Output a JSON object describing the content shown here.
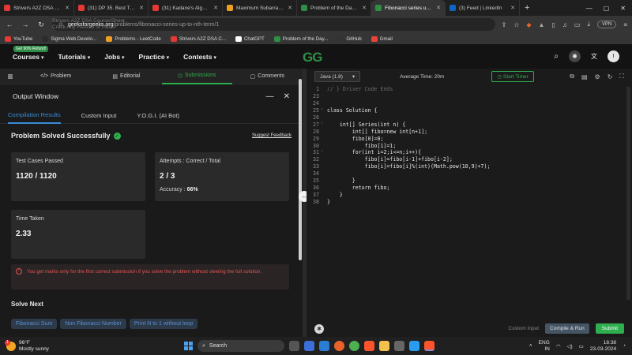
{
  "browser": {
    "tabs": [
      {
        "label": "Strivers A2Z DSA Course",
        "color": "#e53935",
        "active": false
      },
      {
        "label": "(31) DP 35. Best Time to B",
        "color": "#e53935",
        "active": false
      },
      {
        "label": "(31) Kadane's Algorithm |",
        "color": "#e53935",
        "active": false
      },
      {
        "label": "Maximum Subarray - Lee",
        "color": "#f0a020",
        "active": false
      },
      {
        "label": "Problem of the Day | Gee",
        "color": "#2f8d46",
        "active": false
      },
      {
        "label": "Fibonacci series up to n",
        "color": "#2f8d46",
        "active": true
      },
      {
        "label": "(3) Feed | LinkedIn",
        "color": "#0a66c2",
        "active": false
      }
    ],
    "url_host": "geeksforgeeks.org",
    "url_path": "/problems/fibonacci-series-up-to-nth-term/1",
    "ghost_text_1": "Strivers A2Z DSA Course/Sheet",
    "ghost_text_2": "Crack Any FAANG or PBCs",
    "vpn_label": "VPN",
    "bookmarks": [
      "YouTube",
      "Sigma Web Develo...",
      "Problems - LeetCode",
      "Strivers A2Z DSA C...",
      "ChatGPT",
      "Problem of the Day...",
      "GitHub",
      "Gmail"
    ]
  },
  "site": {
    "badge": "Get 90% Refund!",
    "nav": [
      "Courses",
      "Tutorials",
      "Jobs",
      "Practice",
      "Contests"
    ],
    "logo": "GG",
    "avatar": "I"
  },
  "problem_tabs": [
    "Problem",
    "Editorial",
    "Submissions",
    "Comments"
  ],
  "output": {
    "title": "Output Window",
    "tabs": [
      "Compilation Results",
      "Custom Input",
      "Y.O.G.I. (AI Bot)"
    ],
    "status": "Problem Solved Successfully",
    "suggest": "Suggest Feedback",
    "test_cases_label": "Test Cases Passed",
    "test_cases_value": "1120 / 1120",
    "attempts_label": "Attempts : Correct / Total",
    "attempts_value": "2 / 3",
    "accuracy_label": "Accuracy :",
    "accuracy_value": "66%",
    "time_label": "Time Taken",
    "time_value": "2.33",
    "warning": "You get marks only for the first correct submission if you solve the problem without viewing the full solution.",
    "solve_next_title": "Solve Next",
    "solve_next": [
      "Fibonacci Sum",
      "Non Fibonacci Number",
      "Print N to 1 without loop"
    ]
  },
  "editor": {
    "language": "Java (1.8)",
    "avg_time": "Average Time: 20m",
    "start_timer": "Start Timer",
    "lines": [
      {
        "n": "1",
        "t": "// } Driver Code Ends",
        "c": true
      },
      {
        "n": "23",
        "t": ""
      },
      {
        "n": "24",
        "t": ""
      },
      {
        "n": "25",
        "t": "class Solution {"
      },
      {
        "n": "26",
        "t": ""
      },
      {
        "n": "27",
        "t": "    int[] Series(int n) {"
      },
      {
        "n": "28",
        "t": "        int[] fibo=new int[n+1];"
      },
      {
        "n": "29",
        "t": "        fibo[0]=0;"
      },
      {
        "n": "30",
        "t": "            fibo[1]=1;"
      },
      {
        "n": "31",
        "t": "        for(int i=2;i<=n;i++){"
      },
      {
        "n": "32",
        "t": "            fibo[i]=fibo[i-1]+fibo[i-2];"
      },
      {
        "n": "33",
        "t": "            fibo[i]=fibo[i]%(int)(Math.pow(10,9)+7);"
      },
      {
        "n": "34",
        "t": ""
      },
      {
        "n": "35",
        "t": "        }"
      },
      {
        "n": "36",
        "t": "        return fibo;"
      },
      {
        "n": "37",
        "t": "    }"
      },
      {
        "n": "38",
        "t": "}"
      }
    ],
    "custom_input": "Custom Input",
    "compile_run": "Compile & Run",
    "submit": "Submit"
  },
  "taskbar": {
    "temp": "96°F",
    "weather": "Mostly sunny",
    "weather_count": "1",
    "search": "Search",
    "lang1": "ENG",
    "lang2": "IN",
    "time": "18:38",
    "date": "23-03-2024"
  }
}
